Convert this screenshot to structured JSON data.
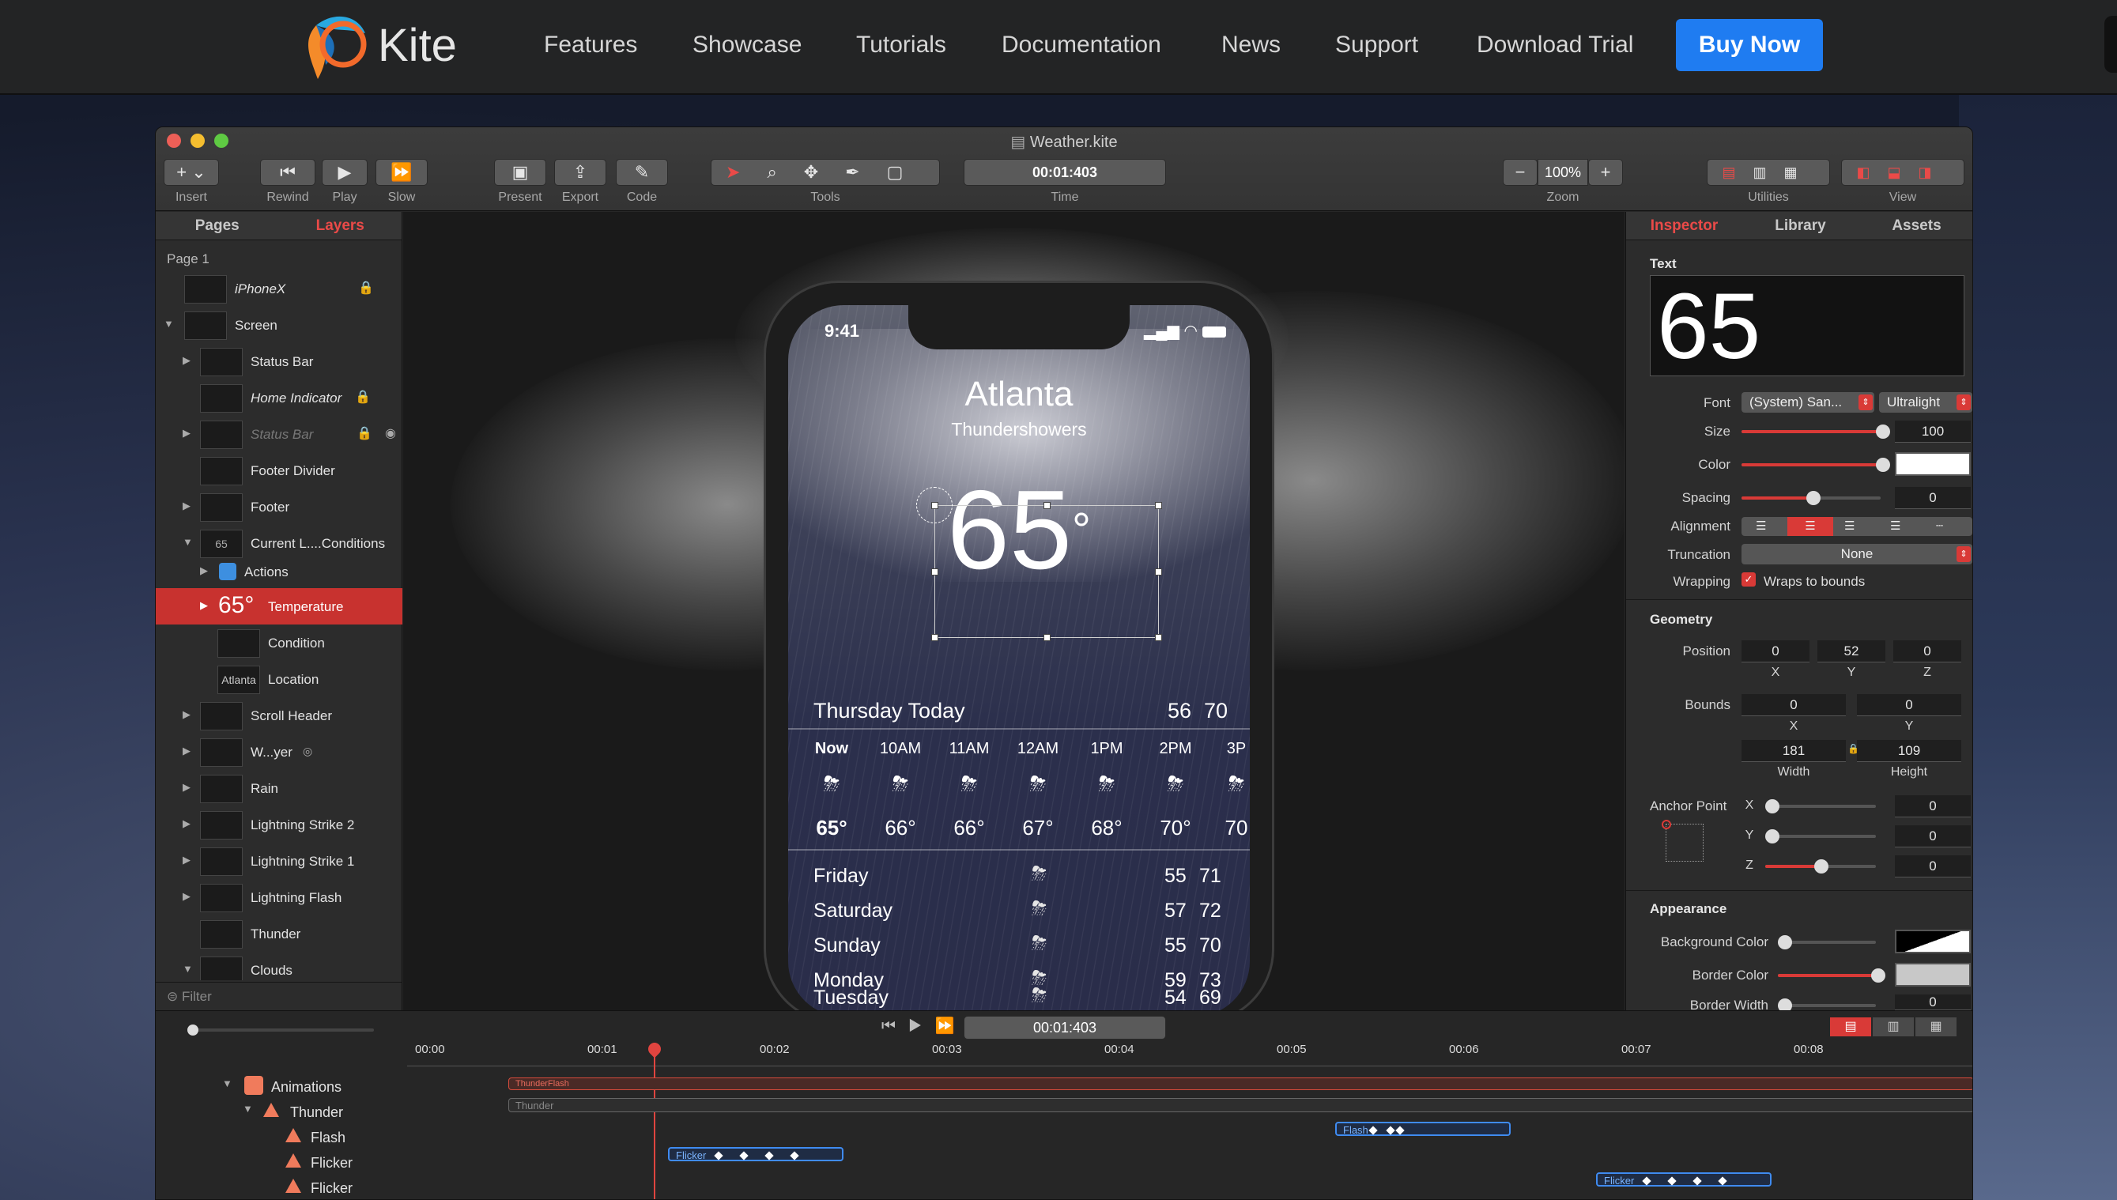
{
  "site": {
    "logo_text": "Kite",
    "nav": [
      "Features",
      "Showcase",
      "Tutorials",
      "Documentation",
      "News",
      "Support",
      "Download Trial"
    ],
    "buy_label": "Buy Now",
    "accent": "#1f7cf1"
  },
  "window": {
    "title": "Weather.kite",
    "toolbar": {
      "insert": "Insert",
      "rewind": "Rewind",
      "play": "Play",
      "slow": "Slow",
      "present": "Present",
      "export": "Export",
      "code": "Code",
      "tools": "Tools",
      "time_value": "00:01:403",
      "time": "Time",
      "zoom_value": "100%",
      "zoom": "Zoom",
      "utilities": "Utilities",
      "view": "View"
    }
  },
  "layers": {
    "tabs": [
      "Pages",
      "Layers"
    ],
    "page": "Page 1",
    "items": [
      {
        "name": "iPhoneX"
      },
      {
        "name": "Screen"
      },
      {
        "name": "Status Bar"
      },
      {
        "name": "Home Indicator"
      },
      {
        "name": "Status Bar"
      },
      {
        "name": "Footer Divider"
      },
      {
        "name": "Footer"
      },
      {
        "name": "Current L....Conditions"
      },
      {
        "name": "Actions"
      },
      {
        "name": "Temperature"
      },
      {
        "name": "Condition"
      },
      {
        "name": "Location"
      },
      {
        "name": "Scroll Header"
      },
      {
        "name": "W...yer"
      },
      {
        "name": "Rain"
      },
      {
        "name": "Lightning Strike 2"
      },
      {
        "name": "Lightning Strike 1"
      },
      {
        "name": "Lightning Flash"
      },
      {
        "name": "Thunder"
      },
      {
        "name": "Clouds"
      }
    ],
    "thumb_temp": "65°",
    "thumb_location": "Atlanta",
    "thumb_cond": "65",
    "filter": "Filter"
  },
  "phone": {
    "time": "9:41",
    "city": "Atlanta",
    "condition": "Thundershowers",
    "temp": "65",
    "degree": "°",
    "today_label": "Thursday  Today",
    "today_lo": "56",
    "today_hi": "70",
    "hours": [
      "Now",
      "10AM",
      "11AM",
      "12AM",
      "1PM",
      "2PM",
      "3P"
    ],
    "hour_temps": [
      "65°",
      "66°",
      "66°",
      "67°",
      "68°",
      "70°",
      "70"
    ],
    "days": [
      {
        "day": "Friday",
        "lo": "55",
        "hi": "71"
      },
      {
        "day": "Saturday",
        "lo": "57",
        "hi": "72"
      },
      {
        "day": "Sunday",
        "lo": "55",
        "hi": "70"
      },
      {
        "day": "Monday",
        "lo": "59",
        "hi": "73"
      },
      {
        "day": "Tuesday",
        "lo": "54",
        "hi": "69"
      }
    ]
  },
  "inspector": {
    "tabs": [
      "Inspector",
      "Library",
      "Assets"
    ],
    "text_section": "Text",
    "text_preview": "65",
    "font_label": "Font",
    "font_value": "(System) San...",
    "weight_value": "Ultralight",
    "size_label": "Size",
    "size_value": "100",
    "color_label": "Color",
    "spacing_label": "Spacing",
    "spacing_value": "0",
    "alignment_label": "Alignment",
    "truncation_label": "Truncation",
    "truncation_value": "None",
    "wrapping_label": "Wrapping",
    "wrapping_value": "Wraps to bounds",
    "geometry_section": "Geometry",
    "position_label": "Position",
    "pos_x": "0",
    "pos_y": "52",
    "pos_z": "0",
    "bounds_label": "Bounds",
    "b_x": "0",
    "b_y": "0",
    "b_w": "181",
    "b_h": "109",
    "x": "X",
    "y": "Y",
    "z": "Z",
    "width": "Width",
    "height": "Height",
    "anchor_label": "Anchor Point",
    "anchor_x": "0",
    "anchor_y": "0",
    "anchor_z": "0",
    "appearance_section": "Appearance",
    "bg_label": "Background Color",
    "border_label": "Border Color",
    "border_width_label": "Border Width",
    "border_width_value": "0",
    "accent": "#d93a37"
  },
  "timeline": {
    "time_value": "00:01:403",
    "ticks": [
      "00:00",
      "00:01",
      "00:02",
      "00:03",
      "00:04",
      "00:05",
      "00:06",
      "00:07",
      "00:08"
    ],
    "rows": [
      "Animations",
      "Thunder",
      "Flash",
      "Flicker",
      "Flicker"
    ],
    "bar_thunderflash": "ThunderFlash",
    "bar_thunder": "Thunder",
    "bar_flicker": "Flicker",
    "bar_flash": "Flash"
  }
}
